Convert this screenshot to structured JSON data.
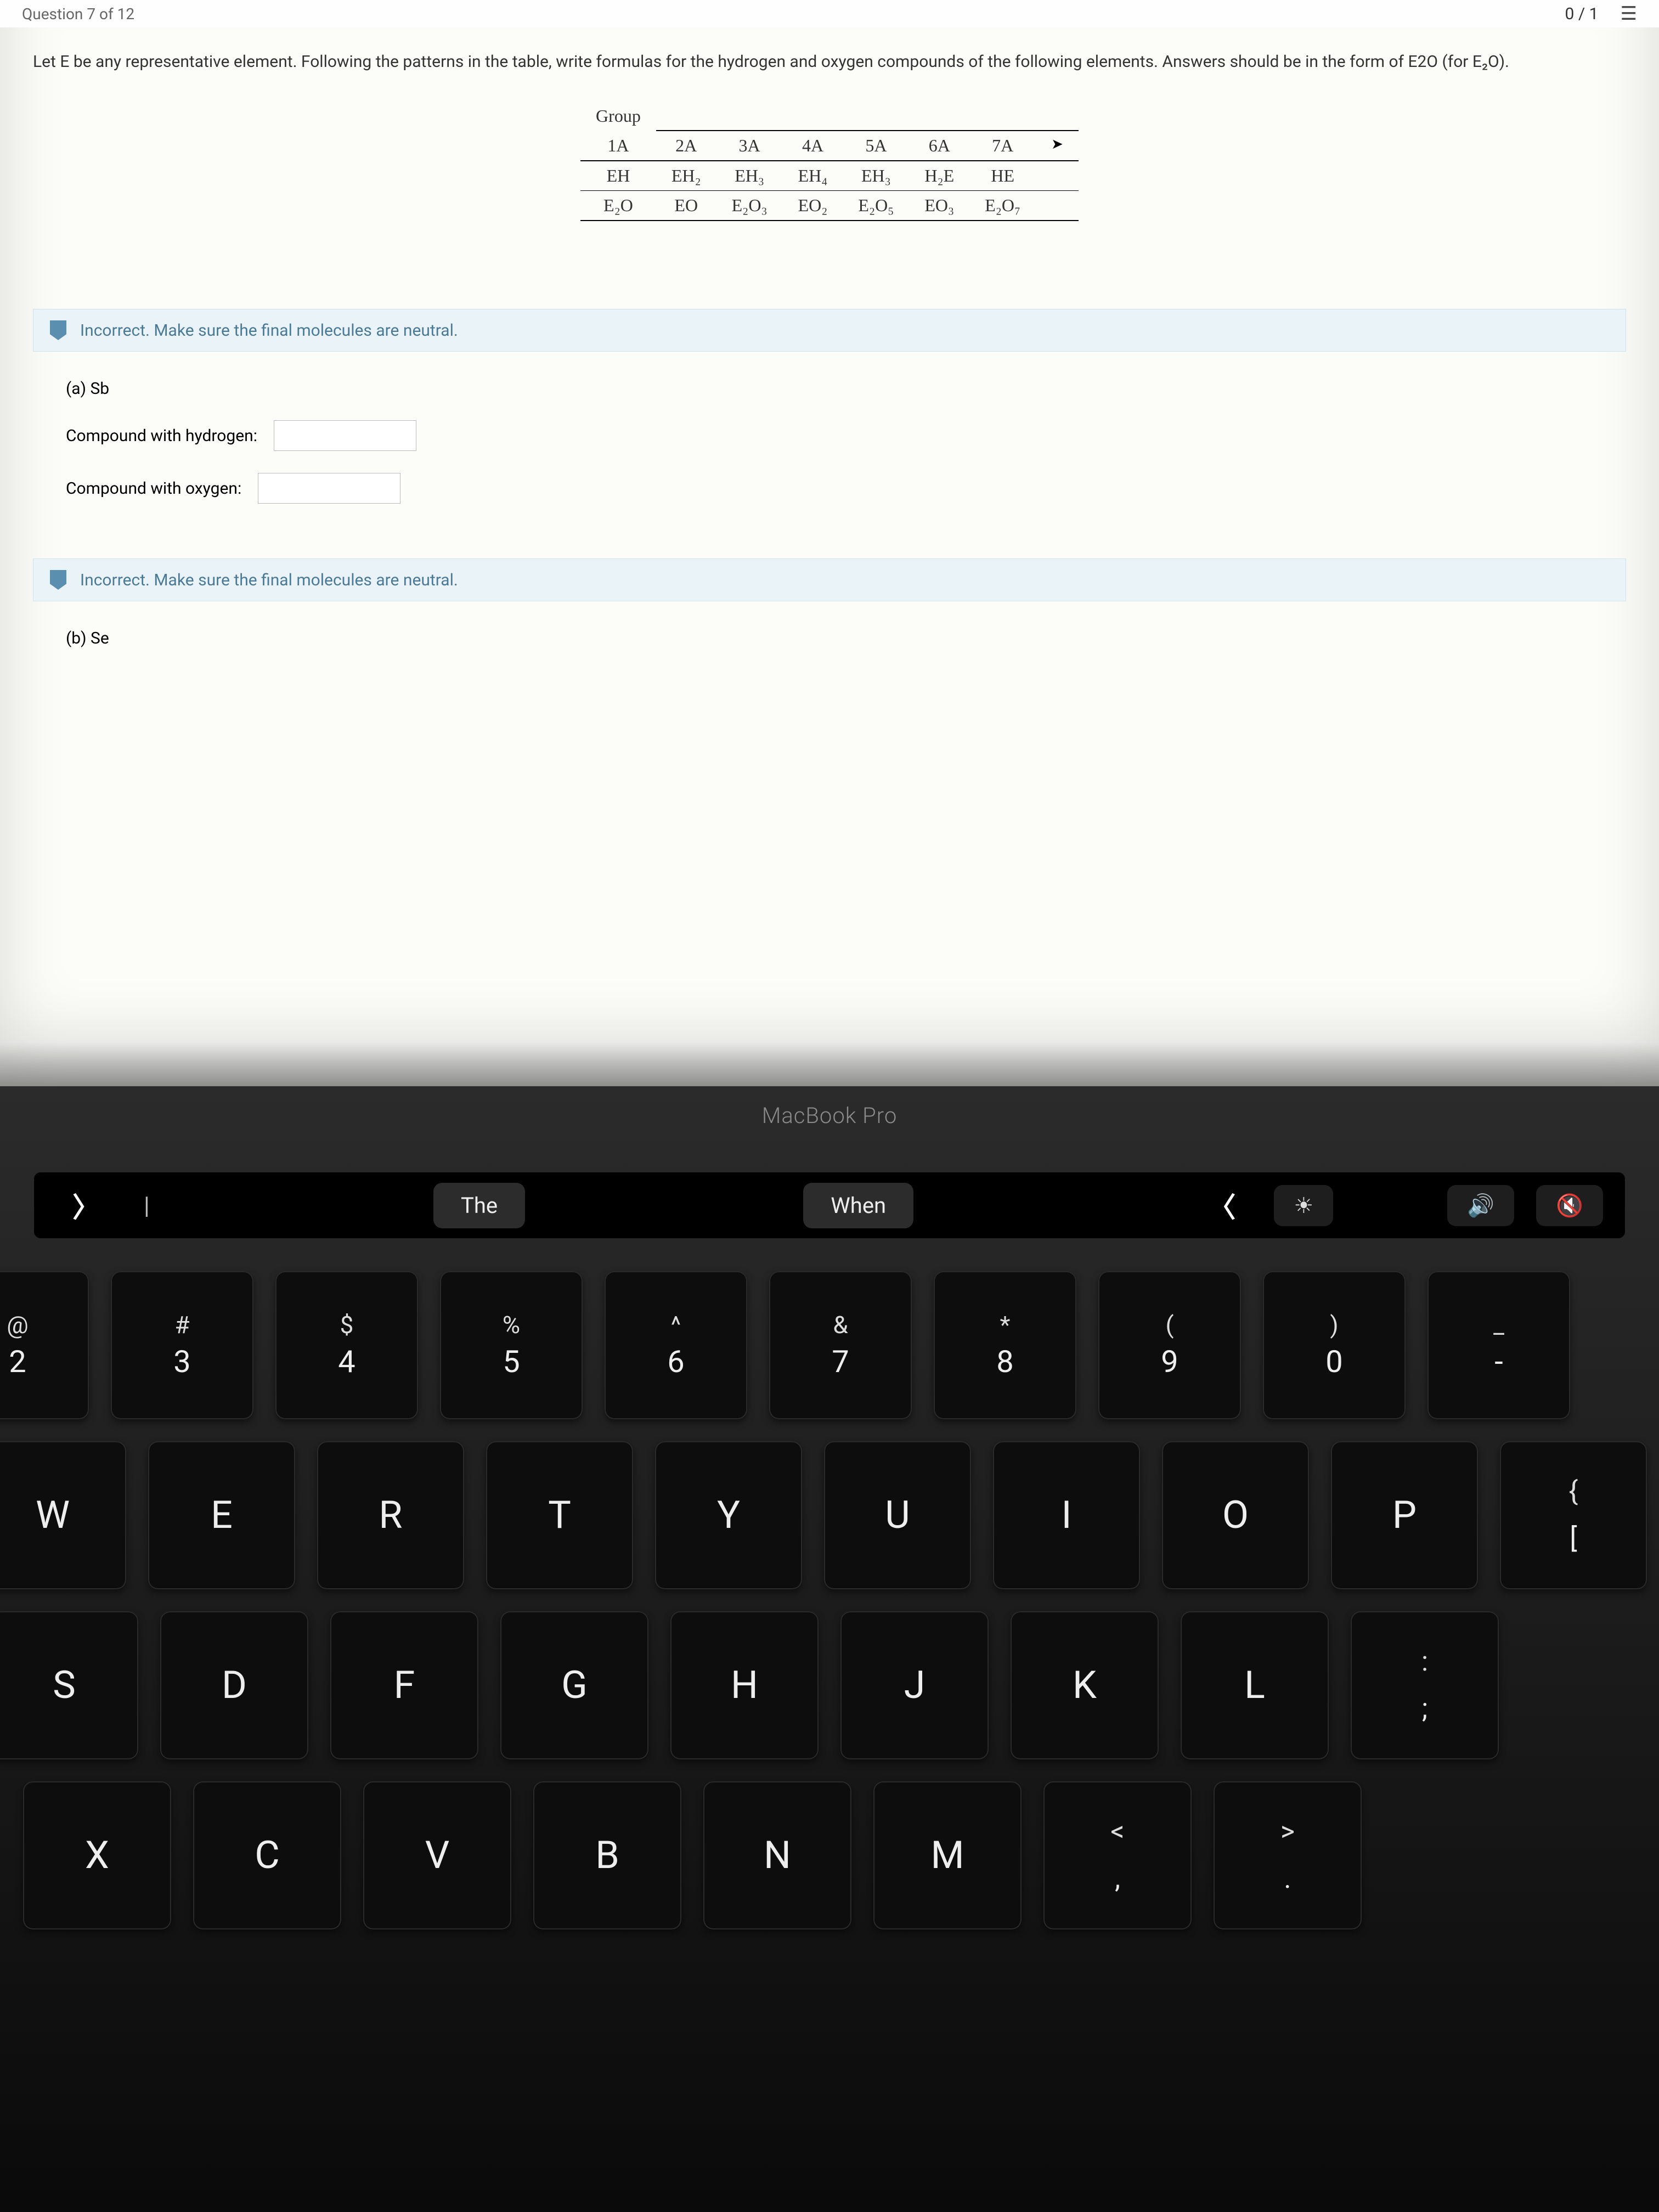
{
  "header": {
    "breadcrumb": "Question 7 of 12",
    "score": "0 / 1",
    "list_icon": "☰"
  },
  "question": {
    "prompt": "Let E be any representative element. Following the patterns in the table, write formulas for the hydrogen and oxygen compounds of the following elements. Answers should be in the form of E2O (for E₂O)."
  },
  "table": {
    "group_label": "Group",
    "headers": [
      "1A",
      "2A",
      "3A",
      "4A",
      "5A",
      "6A",
      "7A"
    ],
    "row_h": [
      "EH",
      "EH₂",
      "EH₃",
      "EH₄",
      "EH₃",
      "H₂E",
      "HE"
    ],
    "row_o": [
      "E₂O",
      "EO",
      "E₂O₃",
      "EO₂",
      "E₂O₅",
      "EO₃",
      "E₂O₇"
    ]
  },
  "feedback": {
    "a": "Incorrect. Make sure the final molecules are neutral.",
    "b": "Incorrect. Make sure the final molecules are neutral."
  },
  "parts": {
    "a": {
      "label": "(a) Sb",
      "h_label": "Compound with hydrogen:",
      "o_label": "Compound with oxygen:"
    },
    "b": {
      "label": "(b) Se"
    }
  },
  "laptop": {
    "model": "MacBook Pro",
    "touchbar": {
      "arrow": "〉",
      "vert": "|",
      "sug1": "The",
      "sug2": "When",
      "back": "〈",
      "brightness": "☀",
      "volume": "🔊",
      "mute": "🔇"
    },
    "numrow": [
      {
        "u": "@",
        "l": "2"
      },
      {
        "u": "#",
        "l": "3"
      },
      {
        "u": "$",
        "l": "4"
      },
      {
        "u": "%",
        "l": "5"
      },
      {
        "u": "^",
        "l": "6"
      },
      {
        "u": "&",
        "l": "7"
      },
      {
        "u": "*",
        "l": "8"
      },
      {
        "u": "(",
        "l": "9"
      },
      {
        "u": ")",
        "l": "0"
      },
      {
        "u": "_",
        "l": "-"
      }
    ],
    "row1": [
      "W",
      "E",
      "R",
      "T",
      "Y",
      "U",
      "I",
      "O",
      "P"
    ],
    "row1_end": {
      "u": "{",
      "l": "["
    },
    "row2": [
      "S",
      "D",
      "F",
      "G",
      "H",
      "J",
      "K",
      "L"
    ],
    "row2_end": {
      "u": ":",
      "l": ";"
    },
    "row3": [
      "X",
      "C",
      "V",
      "B",
      "N",
      "M"
    ],
    "row3_p1": {
      "u": "<",
      "l": ","
    },
    "row3_p2": {
      "u": ">",
      "l": "."
    }
  }
}
